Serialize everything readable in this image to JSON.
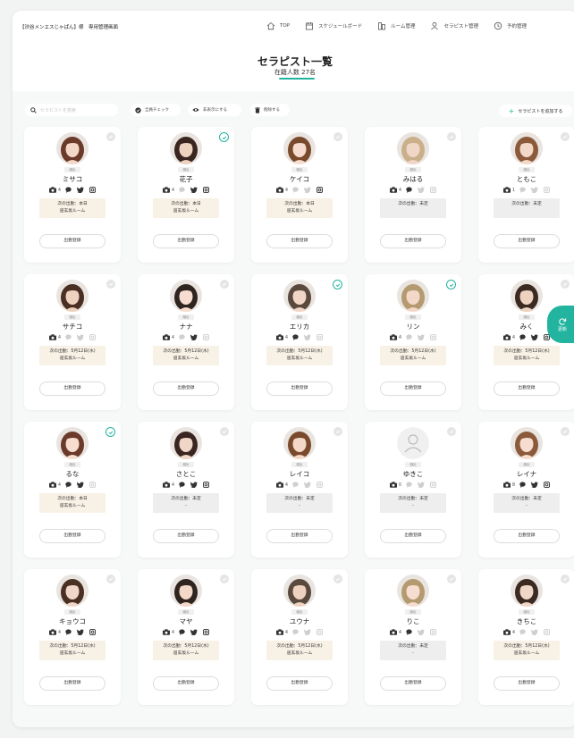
{
  "header": {
    "brand": "【渋谷メンエスじゃぱん】様　専用管理画面",
    "nav": [
      {
        "icon": "home-icon",
        "label": "TOP"
      },
      {
        "icon": "calendar-icon",
        "label": "スケジュールボード"
      },
      {
        "icon": "room-icon",
        "label": "ルーム管理"
      },
      {
        "icon": "user-icon",
        "label": "セラピスト管理"
      },
      {
        "icon": "clock-icon",
        "label": "予約管理"
      }
    ],
    "title": "セラピスト一覧",
    "subtitle": "在籍人数 27名"
  },
  "toolbar": {
    "search_placeholder": "セラピストを検索",
    "check_all": "全員チェック",
    "hide": "非表示にする",
    "delete": "削除する",
    "add": "セラピストを追加する"
  },
  "refresh_label": "更新",
  "register_label": "出勤登録",
  "colors": {
    "accent": "#23b4a0",
    "warm": "#f8f2e6",
    "cool": "#eeeeee"
  },
  "therapists": [
    {
      "name": "ミサコ",
      "badge": "顔出",
      "photos": "4",
      "checked": false,
      "next": "次の出勤：本日",
      "room": "道玄坂ルーム",
      "tone": "warm",
      "social": [
        1,
        1,
        1,
        1
      ]
    },
    {
      "name": "花子",
      "badge": "顔出",
      "photos": "4",
      "checked": true,
      "next": "次の出勤：本日",
      "room": "道玄坂ルーム",
      "tone": "warm",
      "social": [
        1,
        0,
        1,
        1
      ]
    },
    {
      "name": "ケイコ",
      "badge": "顔出",
      "photos": "4",
      "checked": false,
      "next": "次の出勤：本日",
      "room": "道玄坂ルーム",
      "tone": "warm",
      "social": [
        1,
        0,
        0,
        1
      ]
    },
    {
      "name": "みはる",
      "badge": "顔出",
      "photos": "4",
      "checked": false,
      "next": "次の出勤：未定",
      "room": "",
      "tone": "cool",
      "social": [
        1,
        1,
        0,
        0
      ]
    },
    {
      "name": "ともこ",
      "badge": "顔出",
      "photos": "1",
      "checked": false,
      "next": "次の出勤：未定",
      "room": "",
      "tone": "cool",
      "social": [
        1,
        0,
        0,
        0
      ]
    },
    {
      "name": "サチコ",
      "badge": "顔出",
      "photos": "4",
      "checked": false,
      "next": "次の出勤：5月12日(水)",
      "room": "道玄坂ルーム",
      "tone": "warm",
      "social": [
        1,
        0,
        0,
        0
      ]
    },
    {
      "name": "ナナ",
      "badge": "顔出",
      "photos": "4",
      "checked": false,
      "next": "次の出勤：5月12日(水)",
      "room": "道玄坂ルーム",
      "tone": "warm",
      "social": [
        1,
        0,
        1,
        0
      ]
    },
    {
      "name": "エリカ",
      "badge": "顔出",
      "photos": "4",
      "checked": true,
      "next": "次の出勤：5月12日(水)",
      "room": "道玄坂ルーム",
      "tone": "warm",
      "social": [
        1,
        1,
        0,
        0
      ]
    },
    {
      "name": "リン",
      "badge": "顔出",
      "photos": "4",
      "checked": true,
      "next": "次の出勤：5月12日(水)",
      "room": "道玄坂ルーム",
      "tone": "warm",
      "social": [
        1,
        0,
        0,
        0
      ]
    },
    {
      "name": "みく",
      "badge": "顔出",
      "photos": "4",
      "checked": false,
      "next": "次の出勤：5月12日(水)",
      "room": "道玄坂ルーム",
      "tone": "warm",
      "social": [
        1,
        1,
        1,
        1
      ]
    },
    {
      "name": "るな",
      "badge": "顔出",
      "photos": "4",
      "checked": true,
      "next": "次の出勤：本日",
      "room": "道玄坂ルーム",
      "tone": "warm",
      "social": [
        1,
        1,
        1,
        0
      ]
    },
    {
      "name": "さとこ",
      "badge": "顔出",
      "photos": "4",
      "checked": false,
      "next": "次の出勤：未定",
      "room": "-",
      "tone": "cool",
      "social": [
        1,
        1,
        1,
        1
      ]
    },
    {
      "name": "レイコ",
      "badge": "顔出",
      "photos": "4",
      "checked": false,
      "next": "次の出勤：未定",
      "room": "-",
      "tone": "cool",
      "social": [
        1,
        0,
        0,
        0
      ]
    },
    {
      "name": "ゆきこ",
      "badge": "顔出",
      "photos": "0",
      "checked": false,
      "next": "次の出勤：未定",
      "room": "-",
      "tone": "cool",
      "social": [
        1,
        0,
        0,
        0
      ]
    },
    {
      "name": "レイナ",
      "badge": "顔出",
      "photos": "8",
      "checked": false,
      "next": "次の出勤：未定",
      "room": "-",
      "tone": "cool",
      "social": [
        1,
        1,
        1,
        1
      ]
    },
    {
      "name": "キョウコ",
      "badge": "顔出",
      "photos": "4",
      "checked": false,
      "next": "次の出勤：5月12日(水)",
      "room": "道玄坂ルーム",
      "tone": "warm",
      "social": [
        1,
        1,
        1,
        1
      ]
    },
    {
      "name": "マヤ",
      "badge": "顔出",
      "photos": "4",
      "checked": false,
      "next": "次の出勤：5月12日(水)",
      "room": "道玄坂ルーム",
      "tone": "warm",
      "social": [
        1,
        1,
        1,
        1
      ]
    },
    {
      "name": "ユウナ",
      "badge": "顔出",
      "photos": "4",
      "checked": false,
      "next": "次の出勤：5月12日(水)",
      "room": "道玄坂ルーム",
      "tone": "warm",
      "social": [
        1,
        0,
        0,
        0
      ]
    },
    {
      "name": "りこ",
      "badge": "顔出",
      "photos": "4",
      "checked": false,
      "next": "次の出勤：未定",
      "room": "-",
      "tone": "cool",
      "social": [
        1,
        1,
        0,
        0
      ]
    },
    {
      "name": "きちこ",
      "badge": "顔出",
      "photos": "4",
      "checked": false,
      "next": "次の出勤：5月12日(水)",
      "room": "道玄坂ルーム",
      "tone": "warm",
      "social": [
        1,
        0,
        0,
        0
      ]
    }
  ]
}
